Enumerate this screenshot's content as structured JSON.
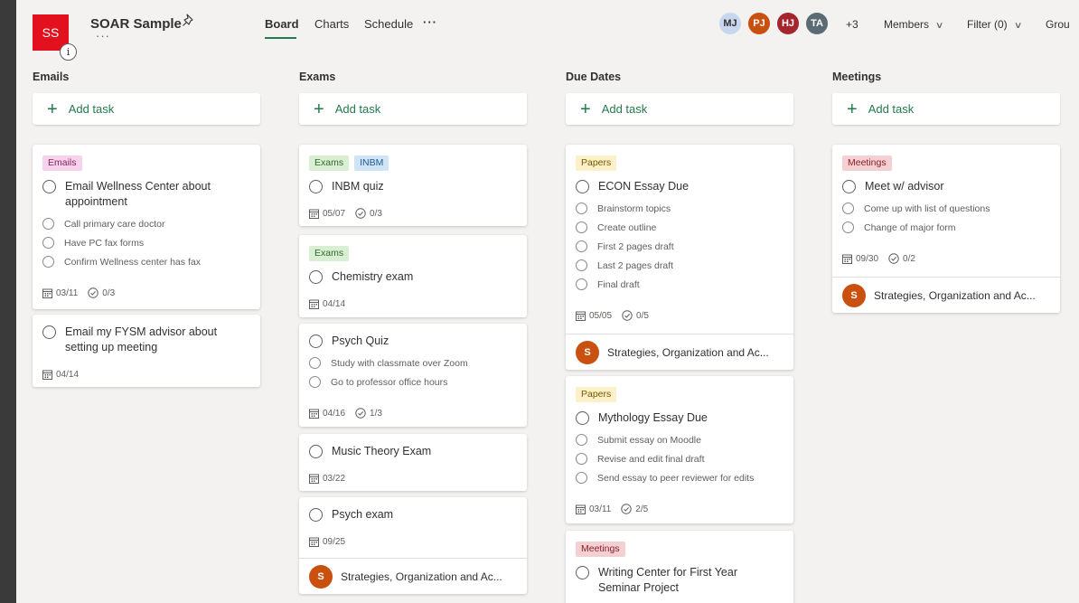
{
  "plan": {
    "initials": "SS",
    "name": "SOAR Sample",
    "info_icon": "i",
    "more": "···",
    "tile_color": "#e3101e"
  },
  "tabs": [
    {
      "label": "Board",
      "active": true
    },
    {
      "label": "Charts",
      "active": false
    },
    {
      "label": "Schedule",
      "active": false
    }
  ],
  "tabs_more": "···",
  "members": [
    {
      "initials": "MJ",
      "color": "#c7d7ee",
      "text_color": "#323130"
    },
    {
      "initials": "PJ",
      "color": "#ca5010",
      "text_color": "#ffffff"
    },
    {
      "initials": "HJ",
      "color": "#a4262c",
      "text_color": "#ffffff"
    },
    {
      "initials": "TA",
      "color": "#5c6b73",
      "text_color": "#ffffff"
    }
  ],
  "more_members": "+3",
  "toolbar": {
    "members_label": "Members",
    "filter_label": "Filter (0)",
    "group_label": "Grou"
  },
  "accent_color": "#237b4b",
  "add_task_label": "Add task",
  "columns": [
    {
      "title": "Emails",
      "cards": [
        {
          "labels": [
            {
              "text": "Emails",
              "bg": "#f6d3ea",
              "fg": "#8b2064"
            }
          ],
          "title": "Email Wellness Center about appointment",
          "checklist": [
            "Call primary care doctor",
            "Have PC fax forms",
            "Confirm Wellness center has fax"
          ],
          "date": "03/11",
          "progress": "0/3"
        },
        {
          "labels": [],
          "title": "Email my FYSM advisor about setting up meeting",
          "checklist": [],
          "date": "04/14"
        }
      ]
    },
    {
      "title": "Exams",
      "cards": [
        {
          "labels": [
            {
              "text": "Exams",
              "bg": "#d9efd3",
              "fg": "#2e6b2a"
            },
            {
              "text": "INBM",
              "bg": "#cfe4f7",
              "fg": "#1d5a8c"
            }
          ],
          "title": "INBM quiz",
          "checklist": [],
          "date": "05/07",
          "progress": "0/3"
        },
        {
          "labels": [
            {
              "text": "Exams",
              "bg": "#d9efd3",
              "fg": "#2e6b2a"
            }
          ],
          "title": "Chemistry exam",
          "checklist": [],
          "date": "04/14"
        },
        {
          "labels": [],
          "title": "Psych Quiz",
          "checklist": [
            "Study with classmate over Zoom",
            "Go to professor office hours"
          ],
          "date": "04/16",
          "progress": "1/3"
        },
        {
          "labels": [],
          "title": "Music Theory Exam",
          "checklist": [],
          "date": "03/22"
        },
        {
          "labels": [],
          "title": "Psych exam",
          "checklist": [],
          "date": "09/25",
          "bucket": {
            "initial": "S",
            "name": "Strategies, Organization and Ac..."
          }
        }
      ]
    },
    {
      "title": "Due Dates",
      "cards": [
        {
          "labels": [
            {
              "text": "Papers",
              "bg": "#fbf0c8",
              "fg": "#7a5a00"
            }
          ],
          "title": "ECON Essay Due",
          "checklist": [
            "Brainstorm topics",
            "Create outline",
            "First 2 pages draft",
            "Last 2 pages draft",
            "Final draft"
          ],
          "date": "05/05",
          "progress": "0/5",
          "bucket": {
            "initial": "S",
            "name": "Strategies, Organization and Ac..."
          }
        },
        {
          "labels": [
            {
              "text": "Papers",
              "bg": "#fbf0c8",
              "fg": "#7a5a00"
            }
          ],
          "title": "Mythology Essay Due",
          "checklist": [
            "Submit essay on Moodle",
            "Revise and edit final draft",
            "Send essay to peer reviewer for edits"
          ],
          "date": "03/11",
          "progress": "2/5"
        },
        {
          "labels": [
            {
              "text": "Meetings",
              "bg": "#f4d0d3",
              "fg": "#8a1f29"
            }
          ],
          "title": "Writing Center for First Year Seminar Project",
          "checklist": []
        }
      ]
    },
    {
      "title": "Meetings",
      "cards": [
        {
          "labels": [
            {
              "text": "Meetings",
              "bg": "#f4d0d3",
              "fg": "#8a1f29"
            }
          ],
          "title": "Meet w/ advisor",
          "checklist": [
            "Come up with list of questions",
            "Change of major form"
          ],
          "date": "09/30",
          "progress": "0/2",
          "bucket": {
            "initial": "S",
            "name": "Strategies, Organization and Ac..."
          }
        }
      ]
    }
  ]
}
